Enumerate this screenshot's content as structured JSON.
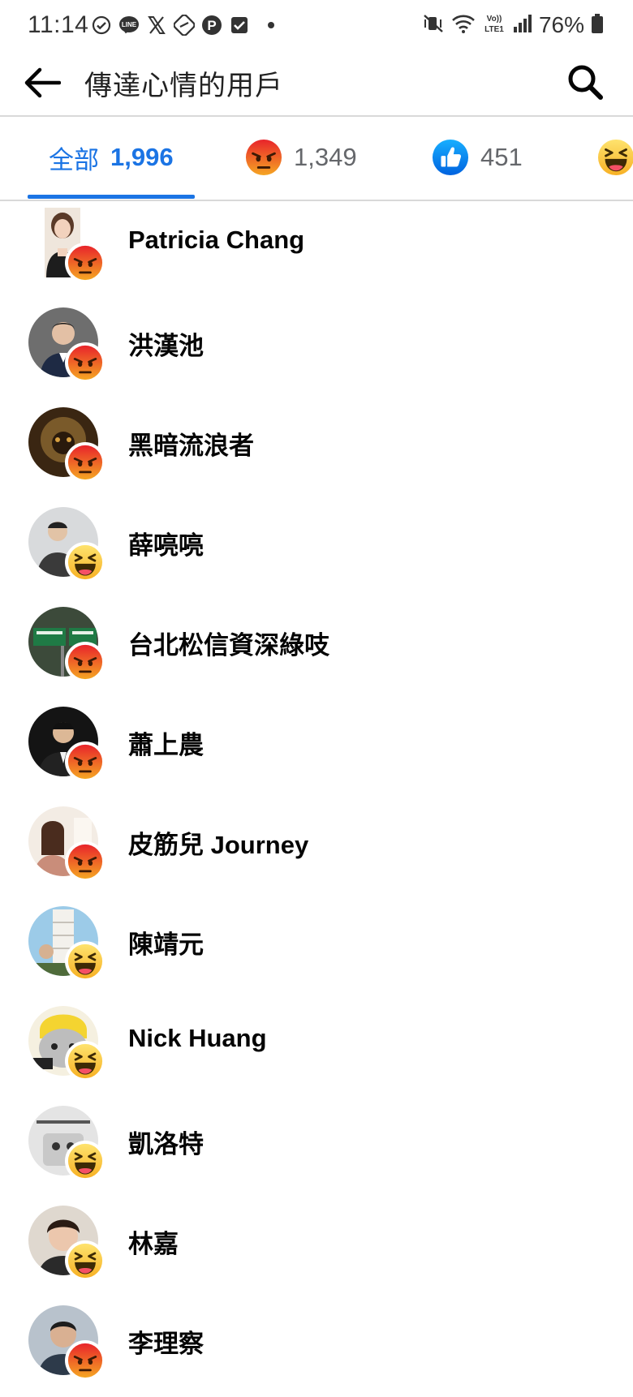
{
  "status_bar": {
    "time": "11:14",
    "battery_percent": "76%",
    "left_icons": [
      "check-circle-icon",
      "line-icon",
      "x-icon",
      "link-icon",
      "p-icon",
      "checkbox-icon"
    ],
    "right_icons": [
      "mute-vibrate-icon",
      "wifi-icon",
      "volte-icon",
      "signal-icon",
      "battery-icon"
    ]
  },
  "header": {
    "title": "傳達心情的用戶"
  },
  "tabs": [
    {
      "label": "全部",
      "count": "1,996",
      "icon": null,
      "active": true
    },
    {
      "label": "",
      "count": "1,349",
      "icon": "angry-reaction-icon",
      "active": false
    },
    {
      "label": "",
      "count": "451",
      "icon": "like-reaction-icon",
      "active": false
    },
    {
      "label": "",
      "count": "",
      "icon": "haha-reaction-icon",
      "active": false
    }
  ],
  "users": [
    {
      "name": "Patricia Chang",
      "reaction": "angry"
    },
    {
      "name": "洪漢池",
      "reaction": "angry"
    },
    {
      "name": "黑暗流浪者",
      "reaction": "angry"
    },
    {
      "name": "薛喨喨",
      "reaction": "haha"
    },
    {
      "name": "台北松信資深綠吱",
      "reaction": "angry"
    },
    {
      "name": "蕭上農",
      "reaction": "angry"
    },
    {
      "name": "皮筋兒 Journey",
      "reaction": "angry"
    },
    {
      "name": "陳靖元",
      "reaction": "haha"
    },
    {
      "name": "Nick Huang",
      "reaction": "haha"
    },
    {
      "name": "凱洛特",
      "reaction": "haha"
    },
    {
      "name": "林嘉",
      "reaction": "haha"
    },
    {
      "name": "李理察",
      "reaction": "angry"
    }
  ],
  "colors": {
    "accent": "#1b74e4",
    "angry": "#e9710f",
    "haha": "#f7b125",
    "like": "#1877f2"
  }
}
